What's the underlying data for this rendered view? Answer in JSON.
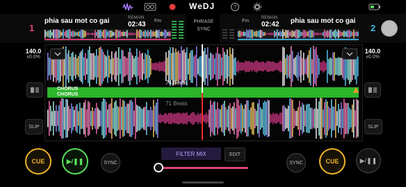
{
  "app": {
    "logo": "WeDJ"
  },
  "top_icons": [
    "waveform-icon",
    "radio-icon",
    "record-icon",
    "help-icon",
    "settings-icon",
    "battery-icon"
  ],
  "colors": {
    "cue": "#f0b429",
    "play": "#58e05a",
    "deck1": "#e0457f",
    "deck2": "#46b5e6",
    "chorus": "#2db52b",
    "playhead2": "#ff2b2b",
    "crossfader": "#e0457f"
  },
  "deck1": {
    "number": "1",
    "track": "phia sau mot co gai",
    "remain_label": "REMAIN",
    "time": "02:43",
    "key": "Fm",
    "bpm": "140.0",
    "bpm_adjust": "±0.0%"
  },
  "deck2": {
    "number": "2",
    "track": "phia sau mot co gai",
    "remain_label": "REMAIN",
    "time": "02:42",
    "key": "Fm",
    "bpm": "140.0",
    "bpm_adjust": "±0.0%"
  },
  "center": {
    "phrase": "PHRASE",
    "sync": "SYNC"
  },
  "waveforms": {
    "top_beats": "74 Beats",
    "bottom_beats": "71 Beats",
    "chorus_top": "CHORUS",
    "chorus_bottom": "CHORUS"
  },
  "side_buttons": {
    "slip_left": "SLIP",
    "slip_right": "SLIP"
  },
  "transport": {
    "cue_left": "CUE",
    "play_left": "▶/❚❚",
    "sync_left": "SYNC",
    "filter_mix": "FILTER MIX",
    "edit": "EDIT",
    "sync_right": "SYNC",
    "cue_right": "CUE",
    "play_right": "▶/❚❚",
    "crossfader_position": 0.0
  }
}
